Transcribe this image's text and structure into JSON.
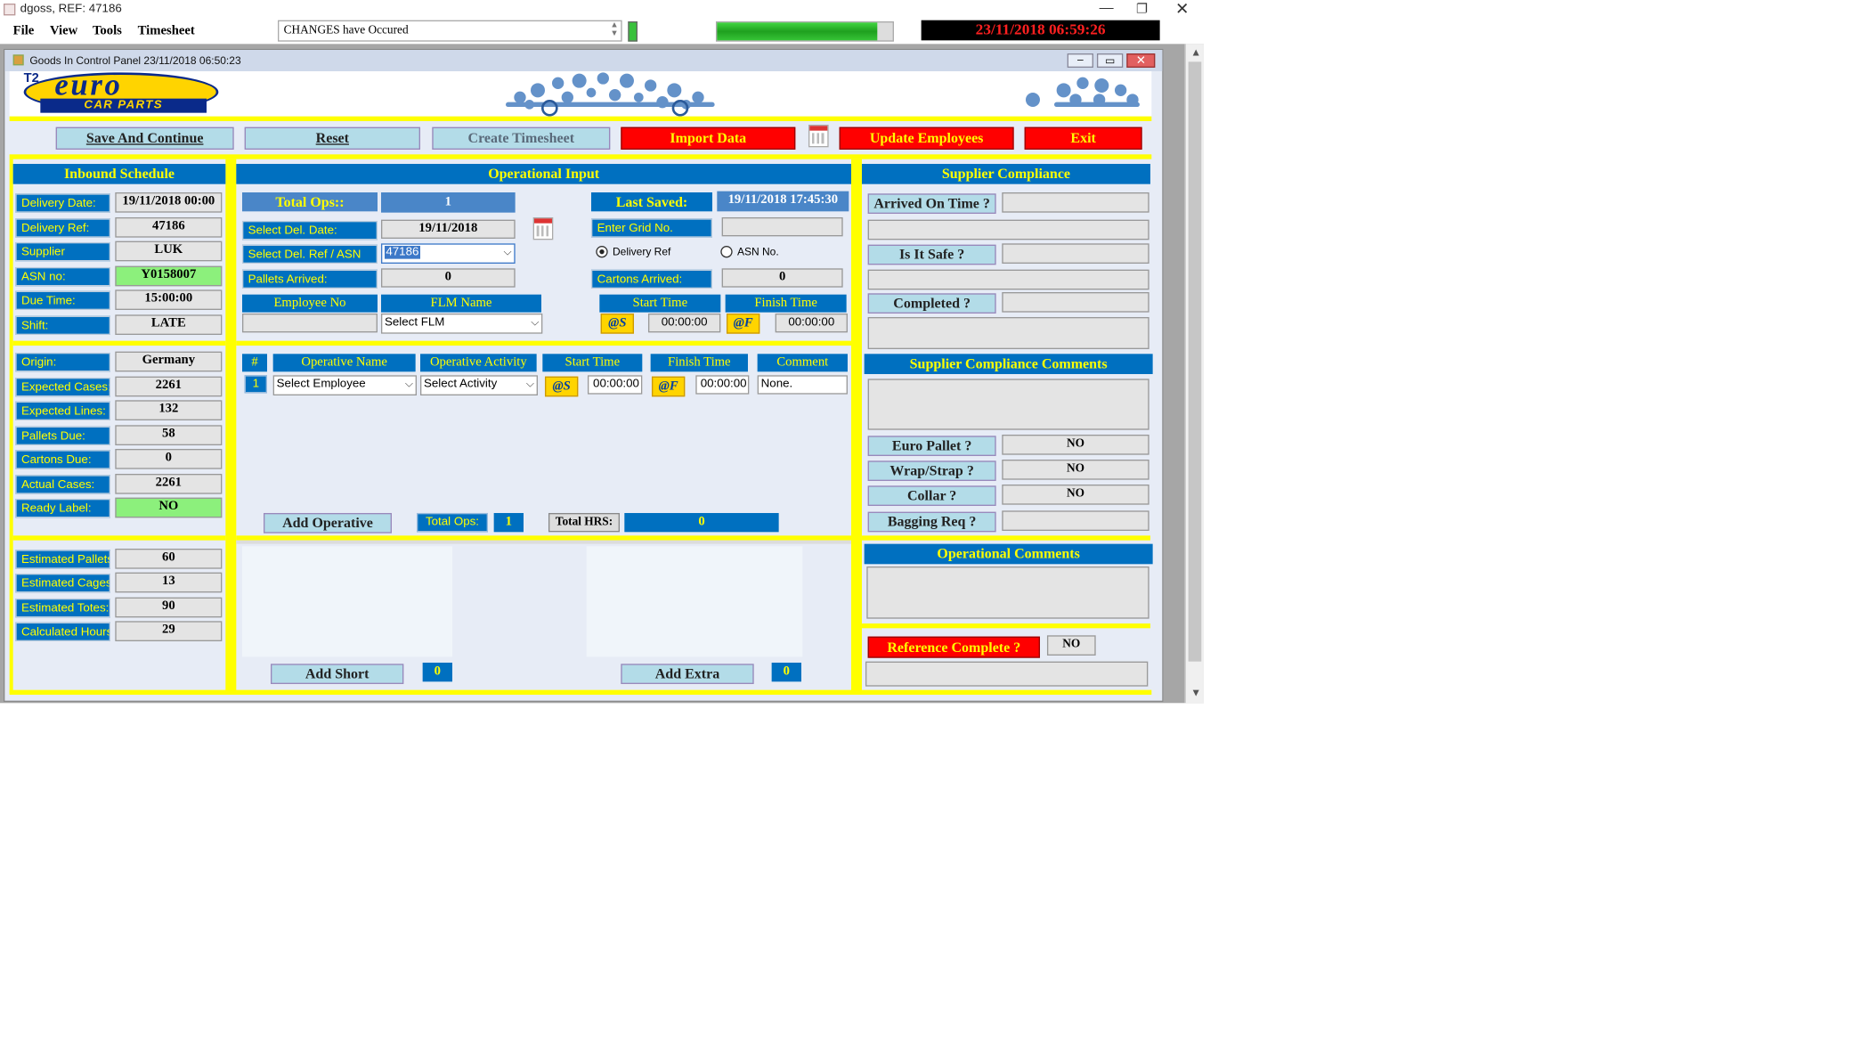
{
  "window": {
    "title": "dgoss, REF: 47186"
  },
  "menu": {
    "file": "File",
    "view": "View",
    "tools": "Tools",
    "timesheet": "Timesheet"
  },
  "status": {
    "message": "CHANGES have Occured",
    "clock": "23/11/2018 06:59:26"
  },
  "child": {
    "title": "Goods In Control Panel 23/11/2018 06:50:23"
  },
  "logo": {
    "line1": "euro",
    "line2": "CAR PARTS",
    "badge": "T2"
  },
  "toolbar": {
    "save": "Save And Continue",
    "reset": "Reset",
    "timesheet": "Create Timesheet",
    "import": "Import Data",
    "update": "Update Employees",
    "exit": "Exit"
  },
  "inbound": {
    "header": "Inbound Schedule",
    "rows": [
      {
        "label": "Delivery Date:",
        "value": "19/11/2018 00:00"
      },
      {
        "label": "Delivery Ref:",
        "value": "47186"
      },
      {
        "label": "Supplier",
        "value": "LUK"
      },
      {
        "label": "ASN no:",
        "value": "Y0158007"
      },
      {
        "label": "Due Time:",
        "value": "15:00:00"
      },
      {
        "label": "Shift:",
        "value": "LATE"
      }
    ],
    "rows2": [
      {
        "label": "Origin:",
        "value": "Germany"
      },
      {
        "label": "Expected Cases:",
        "value": "2261"
      },
      {
        "label": "Expected Lines:",
        "value": "132"
      },
      {
        "label": "Pallets Due:",
        "value": "58"
      },
      {
        "label": "Cartons Due:",
        "value": "0"
      },
      {
        "label": "Actual Cases:",
        "value": "2261"
      },
      {
        "label": "Ready Label:",
        "value": "NO"
      }
    ],
    "rows3": [
      {
        "label": "Estimated Pallets:",
        "value": "60"
      },
      {
        "label": "Estimated Cages:",
        "value": "13"
      },
      {
        "label": "Estimated Totes:",
        "value": "90"
      },
      {
        "label": "Calculated Hours:",
        "value": "29"
      }
    ]
  },
  "operational": {
    "header": "Operational Input",
    "total_ops_label": "Total Ops::",
    "total_ops_value": "1",
    "last_saved_label": "Last Saved:",
    "last_saved_value": "19/11/2018 17:45:30",
    "del_date_label": "Select Del. Date:",
    "del_date_value": "19/11/2018",
    "grid_label": "Enter Grid No.",
    "grid_value": "",
    "ref_label": "Select Del. Ref / ASN",
    "ref_value": "47186",
    "radio_delivery": "Delivery Ref",
    "radio_asn": "ASN No.",
    "pallets_label": "Pallets Arrived:",
    "pallets_value": "0",
    "cartons_label": "Cartons Arrived:",
    "cartons_value": "0",
    "emp_no_label": "Employee No",
    "flm_label": "FLM Name",
    "flm_value": "Select FLM",
    "start_label": "Start Time",
    "finish_label": "Finish Time",
    "start_btn": "@S",
    "finish_btn": "@F",
    "start_value": "00:00:00",
    "finish_value": "00:00:00"
  },
  "ops_table": {
    "headers": [
      "#",
      "Operative Name",
      "Operative Activity",
      "Start Time",
      "Finish Time",
      "Comment"
    ],
    "row": {
      "num": "1",
      "employee": "Select Employee",
      "activity": "Select Activity",
      "start_btn": "@S",
      "start": "00:00:00",
      "finish_btn": "@F",
      "finish": "00:00:00",
      "comment": "None."
    },
    "add_label": "Add Operative",
    "total_ops_label": "Total Ops:",
    "total_ops_value": "1",
    "total_hrs_label": "Total HRS:",
    "total_hrs_value": "0"
  },
  "shorts": {
    "add_short": "Add Short",
    "short_count": "0",
    "add_extra": "Add Extra",
    "extra_count": "0"
  },
  "compliance": {
    "header": "Supplier Compliance",
    "arrived": "Arrived On Time ?",
    "safe": "Is It Safe ?",
    "completed": "Completed ?",
    "comments_header": "Supplier Compliance Comments",
    "euro_pallet": "Euro Pallet ?",
    "euro_pallet_value": "NO",
    "wrap": "Wrap/Strap ?",
    "wrap_value": "NO",
    "collar": "Collar ?",
    "collar_value": "NO",
    "bagging": "Bagging Req ?",
    "bagging_value": "",
    "op_comments_header": "Operational Comments",
    "ref_complete": "Reference Complete ?",
    "ref_complete_value": "NO"
  },
  "colors": {
    "accent_blue": "#0070c0",
    "accent_yellow": "#ffff00",
    "alert_red": "#ff0000",
    "ok_green": "#8cf07c"
  }
}
